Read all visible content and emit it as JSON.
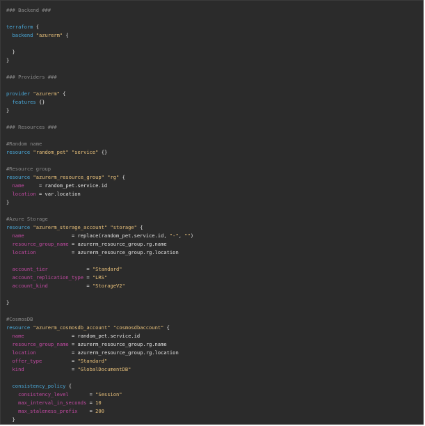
{
  "code_lines": [
    [
      {
        "t": "### Backend ###",
        "k": "c"
      }
    ],
    [],
    [
      {
        "t": "terraform",
        "k": "kw"
      },
      {
        "t": " {",
        "k": "p"
      }
    ],
    [
      {
        "t": "  backend",
        "k": "kw"
      },
      {
        "t": " ",
        "k": "p"
      },
      {
        "t": "\"azurerm\"",
        "k": "s"
      },
      {
        "t": " {",
        "k": "p"
      }
    ],
    [],
    [
      {
        "t": "  }",
        "k": "p"
      }
    ],
    [
      {
        "t": "}",
        "k": "p"
      }
    ],
    [],
    [
      {
        "t": "### Providers ###",
        "k": "c"
      }
    ],
    [],
    [
      {
        "t": "provider",
        "k": "kw"
      },
      {
        "t": " ",
        "k": "p"
      },
      {
        "t": "\"azurerm\"",
        "k": "s"
      },
      {
        "t": " {",
        "k": "p"
      }
    ],
    [
      {
        "t": "  features",
        "k": "kw"
      },
      {
        "t": " {}",
        "k": "p"
      }
    ],
    [
      {
        "t": "}",
        "k": "p"
      }
    ],
    [],
    [
      {
        "t": "### Resources ###",
        "k": "c"
      }
    ],
    [],
    [
      {
        "t": "#Random name",
        "k": "c"
      }
    ],
    [
      {
        "t": "resource",
        "k": "kw"
      },
      {
        "t": " ",
        "k": "p"
      },
      {
        "t": "\"random_pet\"",
        "k": "s"
      },
      {
        "t": " ",
        "k": "p"
      },
      {
        "t": "\"service\"",
        "k": "s"
      },
      {
        "t": " {}",
        "k": "p"
      }
    ],
    [],
    [
      {
        "t": "#Resource group",
        "k": "c"
      }
    ],
    [
      {
        "t": "resource",
        "k": "kw"
      },
      {
        "t": " ",
        "k": "p"
      },
      {
        "t": "\"azurerm_resource_group\"",
        "k": "s"
      },
      {
        "t": " ",
        "k": "p"
      },
      {
        "t": "\"rg\"",
        "k": "s"
      },
      {
        "t": " {",
        "k": "p"
      }
    ],
    [
      {
        "t": "  name",
        "k": "a"
      },
      {
        "t": "     = random_pet.service.id",
        "k": "p"
      }
    ],
    [
      {
        "t": "  location",
        "k": "a"
      },
      {
        "t": " = var.location",
        "k": "p"
      }
    ],
    [
      {
        "t": "}",
        "k": "p"
      }
    ],
    [],
    [
      {
        "t": "#Azure Storage",
        "k": "c"
      }
    ],
    [
      {
        "t": "resource",
        "k": "kw"
      },
      {
        "t": " ",
        "k": "p"
      },
      {
        "t": "\"azurerm_storage_account\"",
        "k": "s"
      },
      {
        "t": " ",
        "k": "p"
      },
      {
        "t": "\"storage\"",
        "k": "s"
      },
      {
        "t": " {",
        "k": "p"
      }
    ],
    [
      {
        "t": "  name",
        "k": "a"
      },
      {
        "t": "                = replace(random_pet.service.id, ",
        "k": "p"
      },
      {
        "t": "\"-\"",
        "k": "s"
      },
      {
        "t": ", ",
        "k": "p"
      },
      {
        "t": "\"\"",
        "k": "s"
      },
      {
        "t": ")",
        "k": "p"
      }
    ],
    [
      {
        "t": "  resource_group_name",
        "k": "a"
      },
      {
        "t": " = azurerm_resource_group.rg.name",
        "k": "p"
      }
    ],
    [
      {
        "t": "  location",
        "k": "a"
      },
      {
        "t": "            = azurerm_resource_group.rg.location",
        "k": "p"
      }
    ],
    [],
    [
      {
        "t": "  account_tier",
        "k": "a"
      },
      {
        "t": "             = ",
        "k": "p"
      },
      {
        "t": "\"Standard\"",
        "k": "s"
      }
    ],
    [
      {
        "t": "  account_replication_type",
        "k": "a"
      },
      {
        "t": " = ",
        "k": "p"
      },
      {
        "t": "\"LRS\"",
        "k": "s"
      }
    ],
    [
      {
        "t": "  account_kind",
        "k": "a"
      },
      {
        "t": "             = ",
        "k": "p"
      },
      {
        "t": "\"StorageV2\"",
        "k": "s"
      }
    ],
    [],
    [
      {
        "t": "}",
        "k": "p"
      }
    ],
    [],
    [
      {
        "t": "#CosmosDB",
        "k": "c"
      }
    ],
    [
      {
        "t": "resource",
        "k": "kw"
      },
      {
        "t": " ",
        "k": "p"
      },
      {
        "t": "\"azurerm_cosmosdb_account\"",
        "k": "s"
      },
      {
        "t": " ",
        "k": "p"
      },
      {
        "t": "\"cosmosdbaccount\"",
        "k": "s"
      },
      {
        "t": " {",
        "k": "p"
      }
    ],
    [
      {
        "t": "  name",
        "k": "a"
      },
      {
        "t": "                = random_pet.service.id",
        "k": "p"
      }
    ],
    [
      {
        "t": "  resource_group_name",
        "k": "a"
      },
      {
        "t": " = azurerm_resource_group.rg.name",
        "k": "p"
      }
    ],
    [
      {
        "t": "  location",
        "k": "a"
      },
      {
        "t": "            = azurerm_resource_group.rg.location",
        "k": "p"
      }
    ],
    [
      {
        "t": "  offer_type",
        "k": "a"
      },
      {
        "t": "          = ",
        "k": "p"
      },
      {
        "t": "\"Standard\"",
        "k": "s"
      }
    ],
    [
      {
        "t": "  kind",
        "k": "a"
      },
      {
        "t": "                = ",
        "k": "p"
      },
      {
        "t": "\"GlobalDocumentDB\"",
        "k": "s"
      }
    ],
    [],
    [
      {
        "t": "  consistency_policy",
        "k": "kw"
      },
      {
        "t": " {",
        "k": "p"
      }
    ],
    [
      {
        "t": "    consistency_level",
        "k": "a"
      },
      {
        "t": "       = ",
        "k": "p"
      },
      {
        "t": "\"Session\"",
        "k": "s"
      }
    ],
    [
      {
        "t": "    max_interval_in_seconds",
        "k": "a"
      },
      {
        "t": " = ",
        "k": "p"
      },
      {
        "t": "10",
        "k": "n"
      }
    ],
    [
      {
        "t": "    max_staleness_prefix",
        "k": "a"
      },
      {
        "t": "    = ",
        "k": "p"
      },
      {
        "t": "200",
        "k": "n"
      }
    ],
    [
      {
        "t": "  }",
        "k": "p"
      }
    ]
  ],
  "colors": {
    "background": "#2b2b2b",
    "comment": "#8a8a8a",
    "keyword": "#4aa8d8",
    "string": "#e8c07a",
    "attribute": "#c34aa3",
    "text": "#e6e6e6"
  }
}
